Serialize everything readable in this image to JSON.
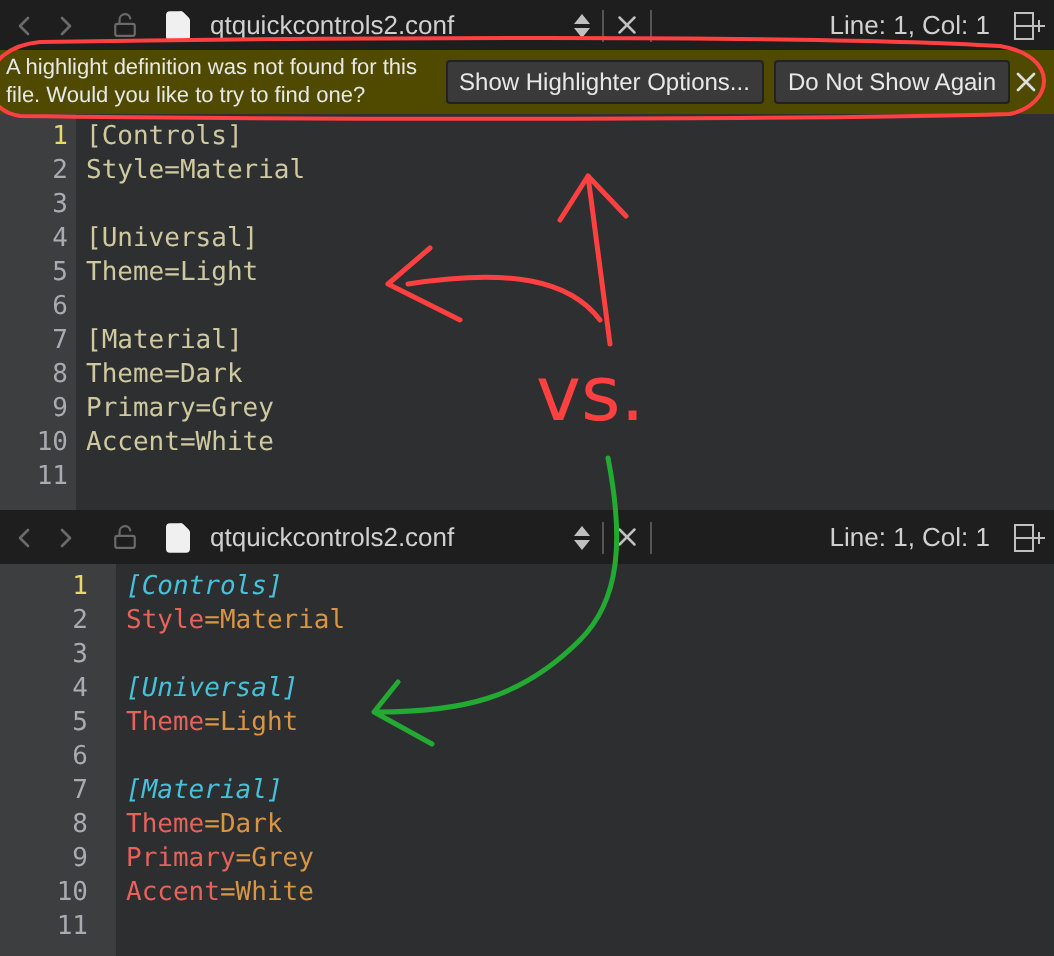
{
  "editors": [
    {
      "toolbar": {
        "file_name": "qtquickcontrols2.conf",
        "position": "Line: 1, Col: 1"
      },
      "info_bar": {
        "message": "A highlight definition was not found for this file. Would you like to try to find one?",
        "buttons": [
          "Show Highlighter Options...",
          "Do Not Show Again"
        ]
      },
      "highlighted": false,
      "lines": [
        {
          "number": "1",
          "current": true,
          "kind": "section",
          "parts": [
            "[Controls]"
          ]
        },
        {
          "number": "2",
          "current": false,
          "kind": "pair",
          "parts": [
            "Style",
            "=",
            "Material"
          ]
        },
        {
          "number": "3",
          "current": false,
          "kind": "blank"
        },
        {
          "number": "4",
          "current": false,
          "kind": "section",
          "parts": [
            "[Universal]"
          ]
        },
        {
          "number": "5",
          "current": false,
          "kind": "pair",
          "parts": [
            "Theme",
            "=",
            "Light"
          ]
        },
        {
          "number": "6",
          "current": false,
          "kind": "blank"
        },
        {
          "number": "7",
          "current": false,
          "kind": "section",
          "parts": [
            "[Material]"
          ]
        },
        {
          "number": "8",
          "current": false,
          "kind": "pair",
          "parts": [
            "Theme",
            "=",
            "Dark"
          ]
        },
        {
          "number": "9",
          "current": false,
          "kind": "pair",
          "parts": [
            "Primary",
            "=",
            "Grey"
          ]
        },
        {
          "number": "10",
          "current": false,
          "kind": "pair",
          "parts": [
            "Accent",
            "=",
            "White"
          ]
        },
        {
          "number": "11",
          "current": false,
          "kind": "blank"
        }
      ]
    },
    {
      "toolbar": {
        "file_name": "qtquickcontrols2.conf",
        "position": "Line: 1, Col: 1"
      },
      "highlighted": true,
      "lines": [
        {
          "number": "1",
          "current": true,
          "kind": "section",
          "parts": [
            "[Controls]"
          ]
        },
        {
          "number": "2",
          "current": false,
          "kind": "pair",
          "parts": [
            "Style",
            "=",
            "Material"
          ]
        },
        {
          "number": "3",
          "current": false,
          "kind": "blank"
        },
        {
          "number": "4",
          "current": false,
          "kind": "section",
          "parts": [
            "[Universal]"
          ]
        },
        {
          "number": "5",
          "current": false,
          "kind": "pair",
          "parts": [
            "Theme",
            "=",
            "Light"
          ]
        },
        {
          "number": "6",
          "current": false,
          "kind": "blank"
        },
        {
          "number": "7",
          "current": false,
          "kind": "section",
          "parts": [
            "[Material]"
          ]
        },
        {
          "number": "8",
          "current": false,
          "kind": "pair",
          "parts": [
            "Theme",
            "=",
            "Dark"
          ]
        },
        {
          "number": "9",
          "current": false,
          "kind": "pair",
          "parts": [
            "Primary",
            "=",
            "Grey"
          ]
        },
        {
          "number": "10",
          "current": false,
          "kind": "pair",
          "parts": [
            "Accent",
            "=",
            "White"
          ]
        },
        {
          "number": "11",
          "current": false,
          "kind": "blank"
        }
      ]
    }
  ],
  "annotation": {
    "text": "vs."
  }
}
